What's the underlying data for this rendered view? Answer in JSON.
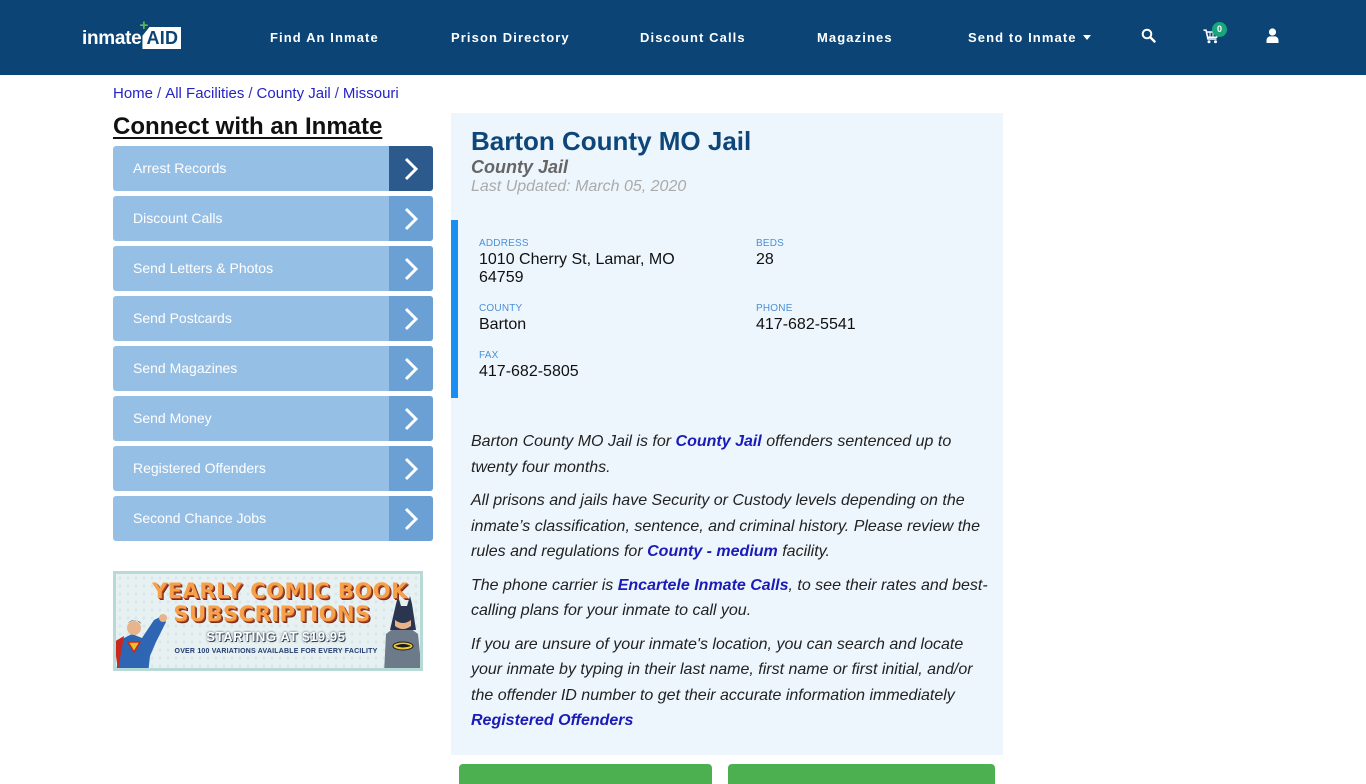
{
  "header": {
    "logo": {
      "part1": "inmate",
      "part2": "AID",
      "plus": "+"
    },
    "nav": [
      {
        "label": "Find An Inmate"
      },
      {
        "label": "Prison Directory"
      },
      {
        "label": "Discount Calls"
      },
      {
        "label": "Magazines"
      },
      {
        "label": "Send to Inmate",
        "has_dropdown": true
      }
    ],
    "icons": {
      "search": "search-icon",
      "cart": "cart-icon",
      "user": "user-icon"
    },
    "cart_count": "0",
    "colors": {
      "bar": "#0b4475",
      "badge": "#1aa67c"
    }
  },
  "breadcrumb": {
    "items": [
      "Home",
      "All Facilities",
      "County Jail",
      "Missouri"
    ],
    "separator": "/"
  },
  "sidebar": {
    "title": "Connect with an Inmate",
    "items": [
      {
        "label": "Arrest Records",
        "active": true
      },
      {
        "label": "Discount Calls"
      },
      {
        "label": "Send Letters & Photos"
      },
      {
        "label": "Send Postcards"
      },
      {
        "label": "Send Magazines"
      },
      {
        "label": "Send Money"
      },
      {
        "label": "Registered Offenders"
      },
      {
        "label": "Second Chance Jobs"
      }
    ],
    "ad": {
      "line1": "YEARLY COMIC BOOK",
      "line2": "SUBSCRIPTIONS",
      "line3": "STARTING AT $19.95",
      "line4": "OVER 100 VARIATIONS AVAILABLE FOR EVERY FACILITY"
    }
  },
  "facility": {
    "name": "Barton County MO Jail",
    "type": "County Jail",
    "updated": "Last Updated: March 05, 2020",
    "info": {
      "address_label": "ADDRESS",
      "address_line1": "1010 Cherry St, Lamar, MO",
      "address_line2": "64759",
      "beds_label": "BEDS",
      "beds": "28",
      "county_label": "COUNTY",
      "county": "Barton",
      "phone_label": "PHONE",
      "phone": "417-682-5541",
      "fax_label": "FAX",
      "fax": "417-682-5805"
    },
    "description": {
      "p1": {
        "before": "Barton County MO Jail is for ",
        "link": "County Jail",
        "after": " offenders sentenced up to twenty four months."
      },
      "p2": {
        "before": "All prisons and jails have Security or Custody levels depending on the inmate’s classification, sentence, and criminal history. Please review the rules and regulations for ",
        "link": "County - medium",
        "after": " facility."
      },
      "p3": {
        "before": "The phone carrier is ",
        "link": "Encartele Inmate Calls",
        "after": ", to see their rates and best-calling plans for your inmate to call you."
      },
      "p4": {
        "before": "If you are unsure of your inmate's location, you can search and locate your inmate by typing in their last name, first name or first initial, and/or the offender ID number to get their accurate information immediately ",
        "link": "Registered Offenders"
      }
    }
  }
}
